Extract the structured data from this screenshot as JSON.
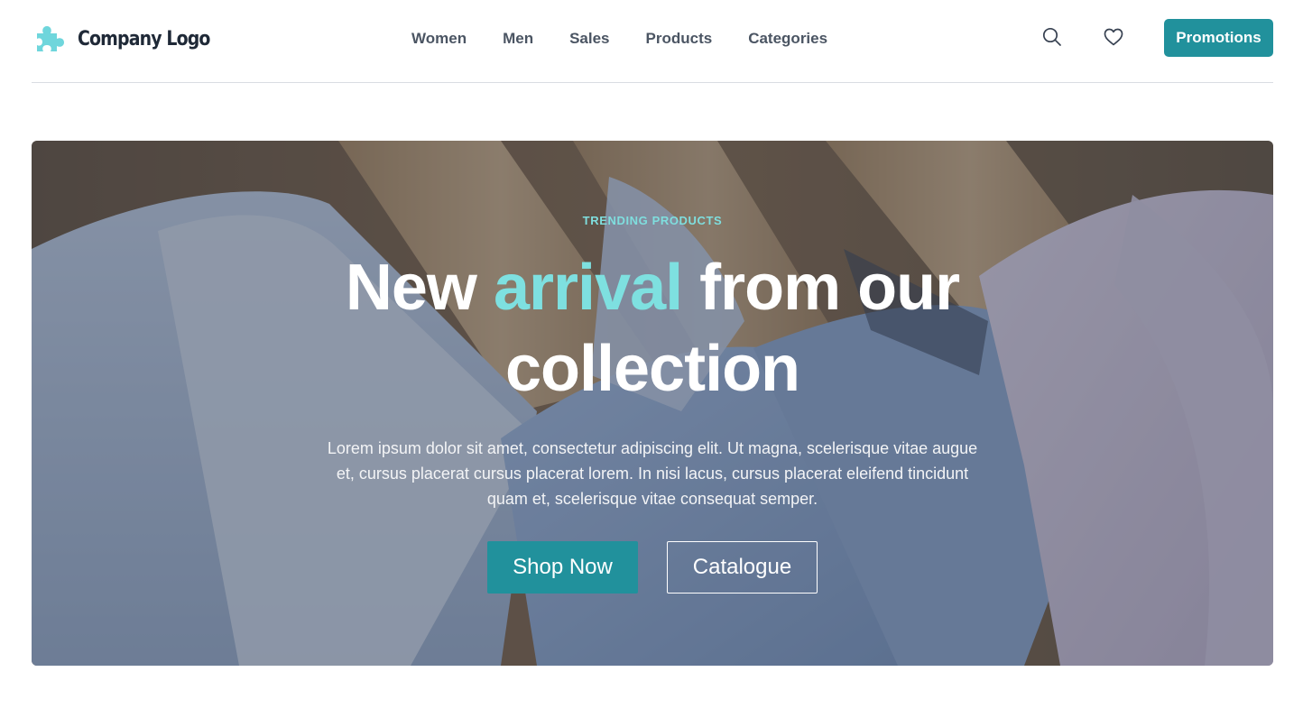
{
  "header": {
    "logo_text": "Company Logo",
    "logo_icon": "puzzle-piece-icon",
    "nav": [
      {
        "label": "Women"
      },
      {
        "label": "Men"
      },
      {
        "label": "Sales"
      },
      {
        "label": "Products"
      },
      {
        "label": "Categories"
      }
    ],
    "search_icon": "search-icon",
    "wishlist_icon": "heart-icon",
    "promo_label": "Promotions"
  },
  "hero": {
    "eyebrow": "TRENDING PRODUCTS",
    "headline_part1": "New ",
    "headline_accent": "arrival",
    "headline_part2": " from our collection",
    "lead": "Lorem ipsum dolor sit amet, consectetur adipiscing elit. Ut magna, scelerisque vitae augue et, cursus placerat cursus placerat lorem. In nisi lacus, cursus placerat eleifend tincidunt quam et, scelerisque vitae consequat semper.",
    "primary_label": "Shop Now",
    "secondary_label": "Catalogue"
  },
  "colors": {
    "brand": "#21919c",
    "accent": "#7ee0e0",
    "logo_mark": "#6fd6dc"
  }
}
